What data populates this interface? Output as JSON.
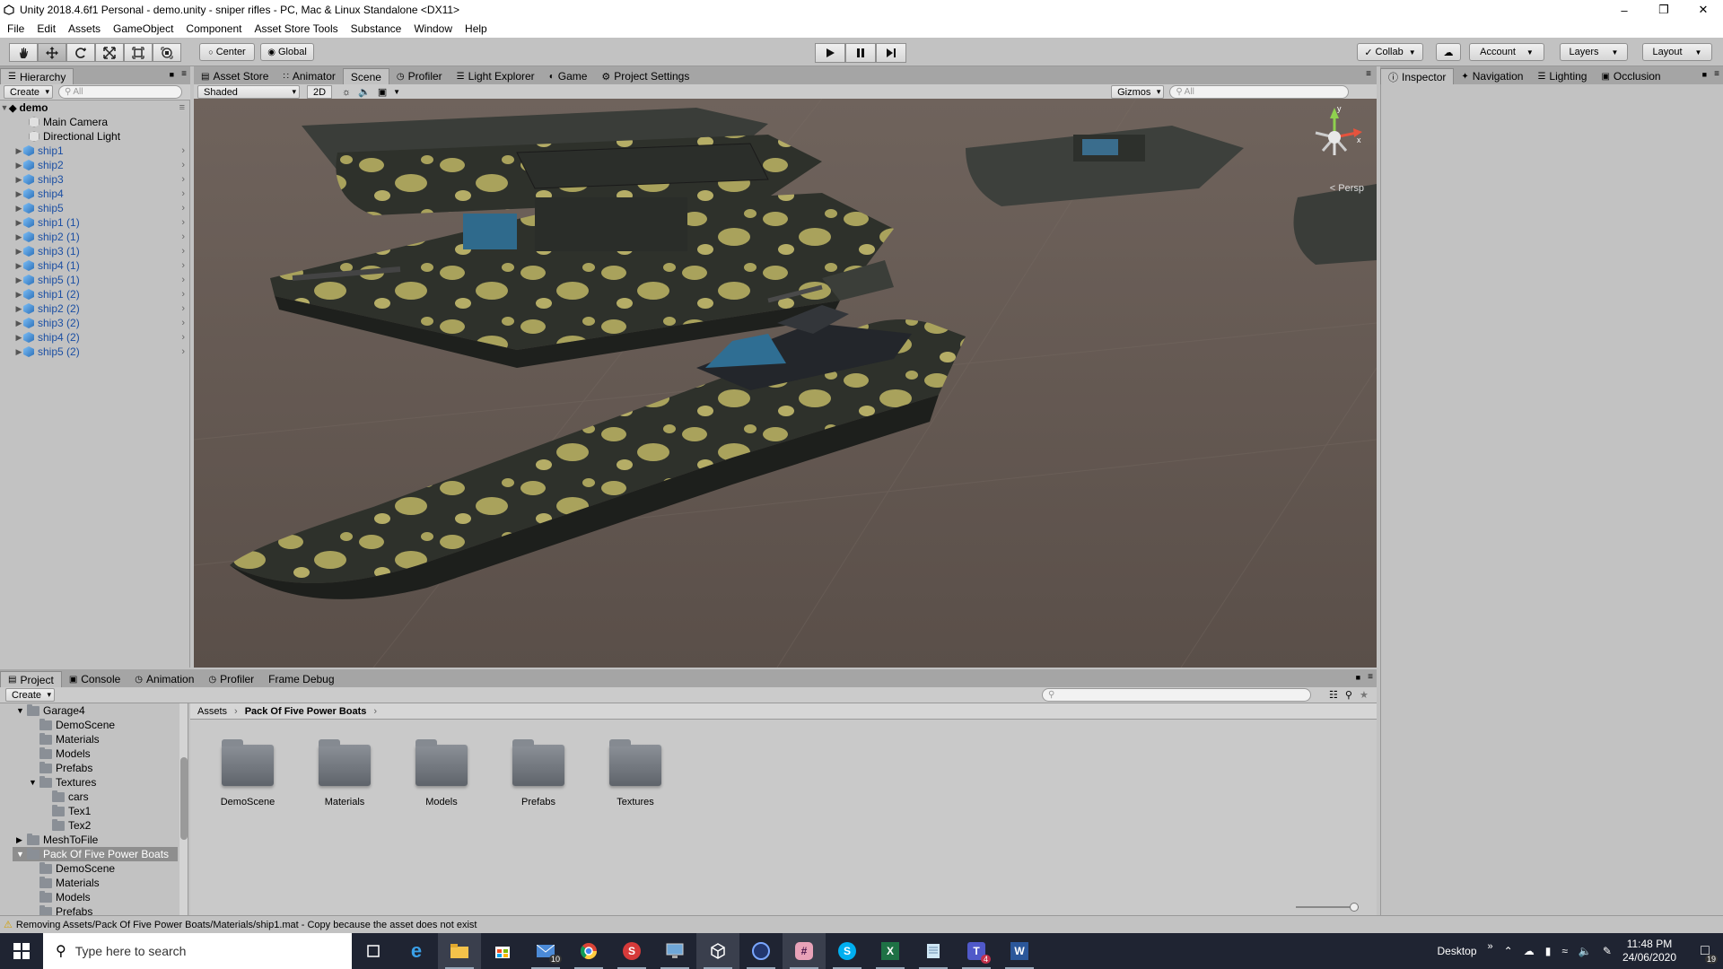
{
  "title_bar": {
    "title": "Unity 2018.4.6f1 Personal - demo.unity - sniper rifles - PC, Mac & Linux Standalone <DX11>"
  },
  "menu": [
    "File",
    "Edit",
    "Assets",
    "GameObject",
    "Component",
    "Asset Store Tools",
    "Substance",
    "Window",
    "Help"
  ],
  "toolbar": {
    "pivot": "Center",
    "space": "Global",
    "collab": "Collab",
    "account": "Account",
    "layers": "Layers",
    "layout": "Layout"
  },
  "hierarchy": {
    "tab": "Hierarchy",
    "create": "Create",
    "search_placeholder": "All",
    "scene": "demo",
    "items": [
      "Main Camera",
      "Directional Light",
      "ship1",
      "ship2",
      "ship3",
      "ship4",
      "ship5",
      "ship1 (1)",
      "ship2 (1)",
      "ship3 (1)",
      "ship4 (1)",
      "ship5 (1)",
      "ship1 (2)",
      "ship2 (2)",
      "ship3 (2)",
      "ship4 (2)",
      "ship5 (2)"
    ]
  },
  "center_tabs": [
    "Asset Store",
    "Animator",
    "Scene",
    "Profiler",
    "Light Explorer",
    "Game",
    "Project Settings"
  ],
  "scene_bar": {
    "shading": "Shaded",
    "mode2d": "2D",
    "gizmos": "Gizmos",
    "search_placeholder": "All",
    "persp": "< Persp",
    "gizmo_y": "y",
    "gizmo_x": "x"
  },
  "inspector_tabs": [
    "Inspector",
    "Navigation",
    "Lighting",
    "Occlusion"
  ],
  "bottom_tabs": [
    "Project",
    "Console",
    "Animation",
    "Profiler",
    "Frame Debug"
  ],
  "project": {
    "create": "Create",
    "tree": [
      "Garage4",
      "DemoScene",
      "Materials",
      "Models",
      "Prefabs",
      "Textures",
      "cars",
      "Tex1",
      "Tex2",
      "MeshToFile",
      "Pack Of Five Power Boats",
      "DemoScene",
      "Materials",
      "Models",
      "Prefabs"
    ],
    "breadcrumb": [
      "Assets",
      "Pack Of Five Power Boats"
    ],
    "assets": [
      "DemoScene",
      "Materials",
      "Models",
      "Prefabs",
      "Textures"
    ]
  },
  "status": {
    "message": "Removing Assets/Pack Of Five Power Boats/Materials/ship1.mat - Copy because the asset does not exist"
  },
  "taskbar": {
    "search_placeholder": "Type here to search",
    "desktop": "Desktop",
    "time": "11:48 PM",
    "date": "24/06/2020",
    "mail_badge": "10",
    "teams_badge": "4",
    "notif_badge": "19"
  },
  "colors": {
    "scene_bg": "#6b5f58",
    "selection": "#3d80df",
    "taskbar": "#1f2432",
    "boat_camo_light": "#a9a25c",
    "boat_camo_dark": "#2b2e28"
  }
}
